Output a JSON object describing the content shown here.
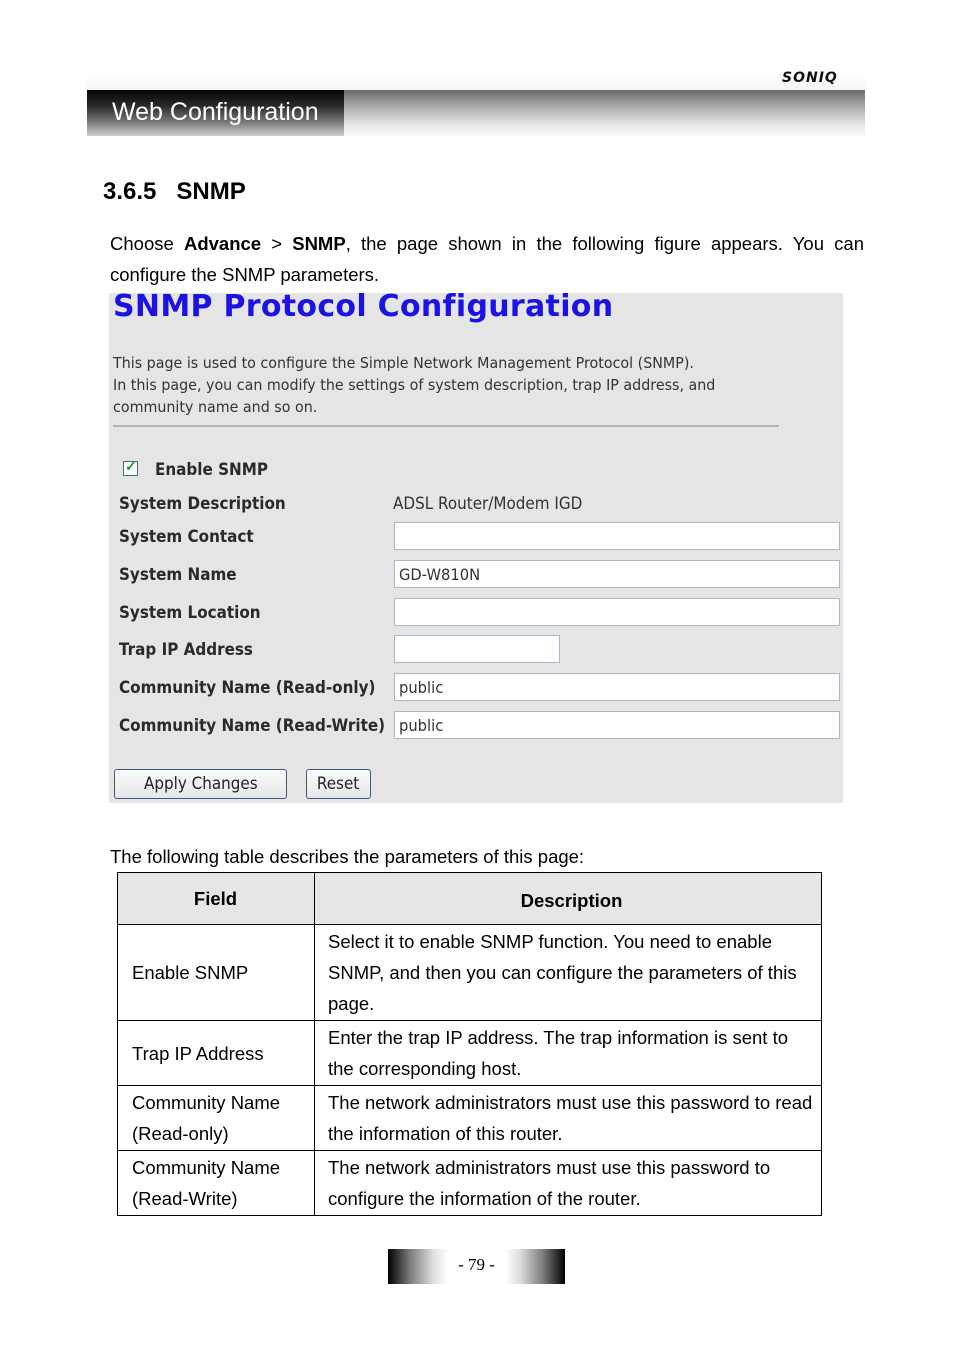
{
  "header": {
    "brand": "SONIQ",
    "chapter_title": "Web Configuration"
  },
  "section": {
    "number": "3.6.5",
    "title": "SNMP",
    "intro_prefix": "Choose ",
    "menu_path_1": "Advance",
    "separator": " > ",
    "menu_path_2": "SNMP",
    "intro_suffix": ", the page shown in the following figure appears. You can configure the SNMP parameters."
  },
  "figure": {
    "title": "SNMP Protocol Configuration",
    "description_lines": [
      "This page is used to configure the Simple Network Management Protocol (SNMP).",
      "In this page, you can modify the settings of system description, trap IP address, and",
      "community name and so on."
    ],
    "enable_snmp": {
      "label": "Enable SNMP",
      "checked": true
    },
    "fields": {
      "system_description": {
        "label": "System Description",
        "value": "ADSL Router/Modem IGD"
      },
      "system_contact": {
        "label": "System Contact",
        "value": ""
      },
      "system_name": {
        "label": "System Name",
        "value": "GD-W810N"
      },
      "system_location": {
        "label": "System Location",
        "value": ""
      },
      "trap_ip": {
        "label": "Trap IP Address",
        "value": ""
      },
      "community_ro": {
        "label": "Community Name (Read-only)",
        "value": "public"
      },
      "community_rw": {
        "label": "Community Name (Read-Write)",
        "value": "public"
      }
    },
    "buttons": {
      "apply": "Apply Changes",
      "reset": "Reset"
    },
    "colors": {
      "title": "#1a12e6",
      "background": "#e5e5e5"
    }
  },
  "table": {
    "intro": "The following table describes the parameters of this page:",
    "headers": [
      "Field",
      "Description"
    ],
    "rows": [
      {
        "field": "Enable SNMP",
        "description": "Select it to enable SNMP function. You need to enable SNMP, and then you can configure the parameters of this page."
      },
      {
        "field": "Trap IP Address",
        "description": "Enter the trap IP address. The trap information is sent to the corresponding host."
      },
      {
        "field": "Community Name (Read-only)",
        "description": "The network administrators must use this password to read the information of this router."
      },
      {
        "field": "Community Name (Read-Write)",
        "description": "The network administrators must use this password to configure the information of the router."
      }
    ]
  },
  "footer": {
    "page_number": "- 79 -"
  }
}
